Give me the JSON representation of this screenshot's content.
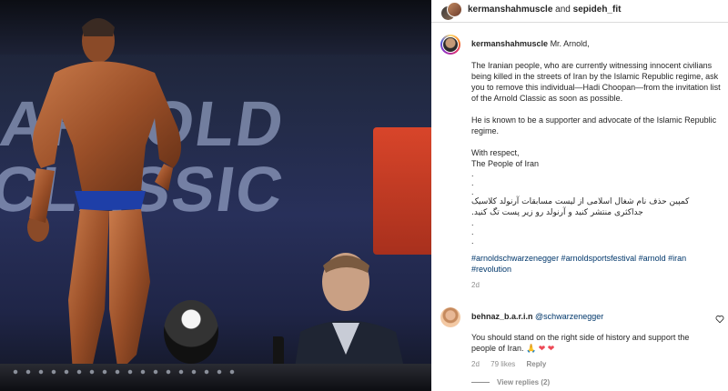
{
  "header": {
    "user1": "kermanshahmuscle",
    "conjunction": "and",
    "user2": "sepideh_fit"
  },
  "photo": {
    "banner_text": "ARNOLD CLASSIC",
    "alt": "bodybuilder on stage and man in audience"
  },
  "post": {
    "username": "kermanshahmuscle",
    "greeting": "Mr. Arnold,",
    "paragraph1": "The Iranian people, who are currently witnessing innocent civilians being killed in the streets of Iran by the Islamic Republic regime, ask you to remove this individual—Hadi Choopan—from the invitation list of the Arnold Classic as soon as possible.",
    "paragraph2": "He is known to be a supporter and advocate of the Islamic Republic regime.",
    "signoff1": "With respect,",
    "signoff2": "The People of Iran",
    "dot": ".",
    "persian1": "کمپین حذف نام شغال اسلامی از لیست مسابقات آرنولد کلاسیک",
    "persian2": "جداکثری منتشر کنید و آرنولد رو زیر پست تگ کنید.",
    "hashtags": "#arnoldschwarzenegger #arnoldsportsfestival #arnold #iran #revolution",
    "age": "2d"
  },
  "comment": {
    "username": "behnaz_b.a.r.i.n",
    "mention": "@schwarzenegger",
    "text": "You should stand on the right side of history and support the people of Iran.",
    "emojis": "🙏 ❤ ❤",
    "age": "2d",
    "likes": "79 likes",
    "reply": "Reply",
    "view_replies": "View replies (2)"
  },
  "colors": {
    "link": "#00376b",
    "muted": "#8e8e8e",
    "heart": "#ed4956"
  }
}
